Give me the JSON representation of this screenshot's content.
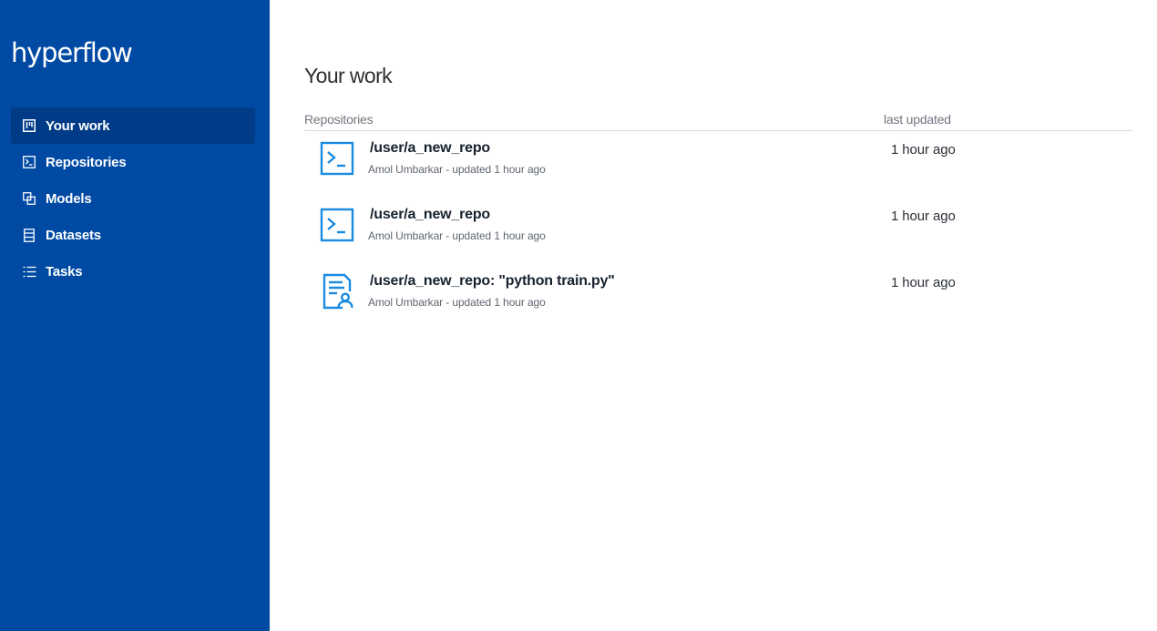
{
  "app": {
    "logo_text": "hyperflow"
  },
  "sidebar": {
    "items": [
      {
        "label": "Your work",
        "icon": "board-icon",
        "active": true
      },
      {
        "label": "Repositories",
        "icon": "terminal-icon",
        "active": false
      },
      {
        "label": "Models",
        "icon": "models-icon",
        "active": false
      },
      {
        "label": "Datasets",
        "icon": "datasets-icon",
        "active": false
      },
      {
        "label": "Tasks",
        "icon": "tasks-icon",
        "active": false
      }
    ]
  },
  "main": {
    "title": "Your work",
    "columns": {
      "repositories": "Repositories",
      "last_updated": "last updated"
    },
    "rows": [
      {
        "icon": "terminal-icon",
        "title": "/user/a_new_repo",
        "subtitle": "Amol Umbarkar - updated 1 hour ago",
        "updated": "1 hour ago"
      },
      {
        "icon": "terminal-icon",
        "title": "/user/a_new_repo",
        "subtitle": "Amol Umbarkar - updated 1 hour ago",
        "updated": "1 hour ago"
      },
      {
        "icon": "task-document-icon",
        "title": "/user/a_new_repo: \"python train.py\"",
        "subtitle": "Amol Umbarkar - updated 1 hour ago",
        "updated": "1 hour ago"
      }
    ]
  },
  "colors": {
    "sidebar_bg": "#004aa3",
    "sidebar_active_bg": "#003b87",
    "icon_accent": "#1a8be0"
  }
}
